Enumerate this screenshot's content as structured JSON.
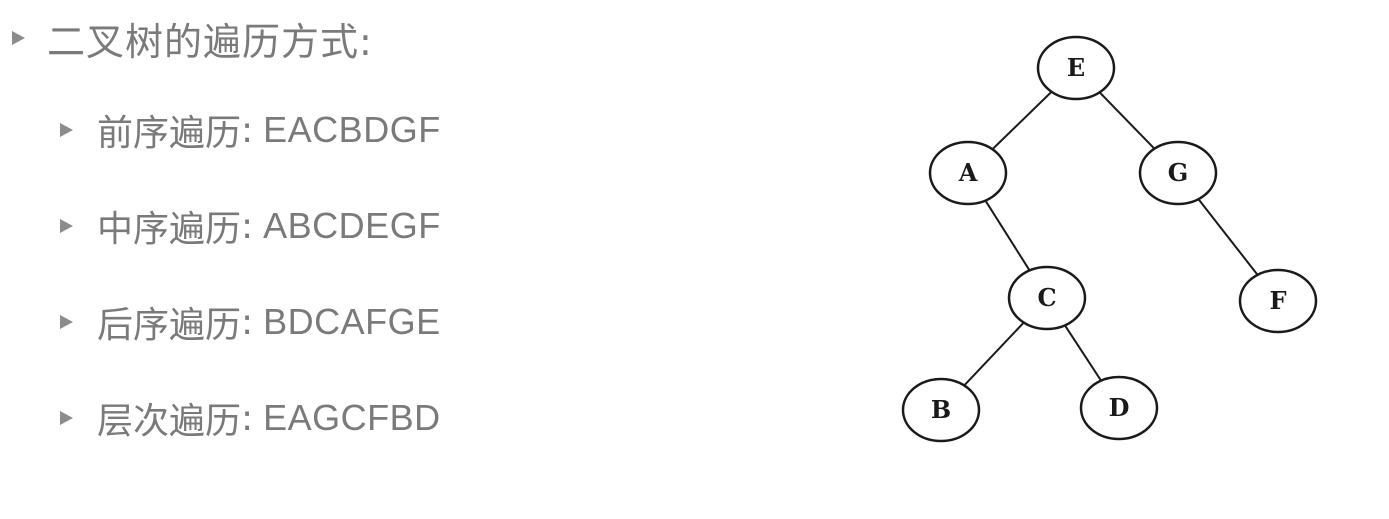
{
  "heading": "二叉树的遍历方式:",
  "traversals": [
    {
      "label": "前序遍历",
      "colon": ":",
      "sequence": "EACBDGF"
    },
    {
      "label": "中序遍历",
      "colon": ":",
      "sequence": "ABCDEGF"
    },
    {
      "label": "后序遍历",
      "colon": ":",
      "sequence": "BDCAFGE"
    },
    {
      "label": "层次遍历",
      "colon": ":",
      "sequence": "EAGCFBD"
    }
  ],
  "tree": {
    "nodes": [
      {
        "id": "E",
        "label": "E"
      },
      {
        "id": "A",
        "label": "A"
      },
      {
        "id": "G",
        "label": "G"
      },
      {
        "id": "C",
        "label": "C"
      },
      {
        "id": "F",
        "label": "F"
      },
      {
        "id": "B",
        "label": "B"
      },
      {
        "id": "D",
        "label": "D"
      }
    ],
    "edges": [
      {
        "from": "E",
        "to": "A"
      },
      {
        "from": "E",
        "to": "G"
      },
      {
        "from": "A",
        "to": "C"
      },
      {
        "from": "G",
        "to": "F"
      },
      {
        "from": "C",
        "to": "B"
      },
      {
        "from": "C",
        "to": "D"
      }
    ]
  },
  "colors": {
    "text": "#7a7a7a",
    "bullet": "#8c8c8c",
    "node_stroke": "#1a1a1a"
  }
}
